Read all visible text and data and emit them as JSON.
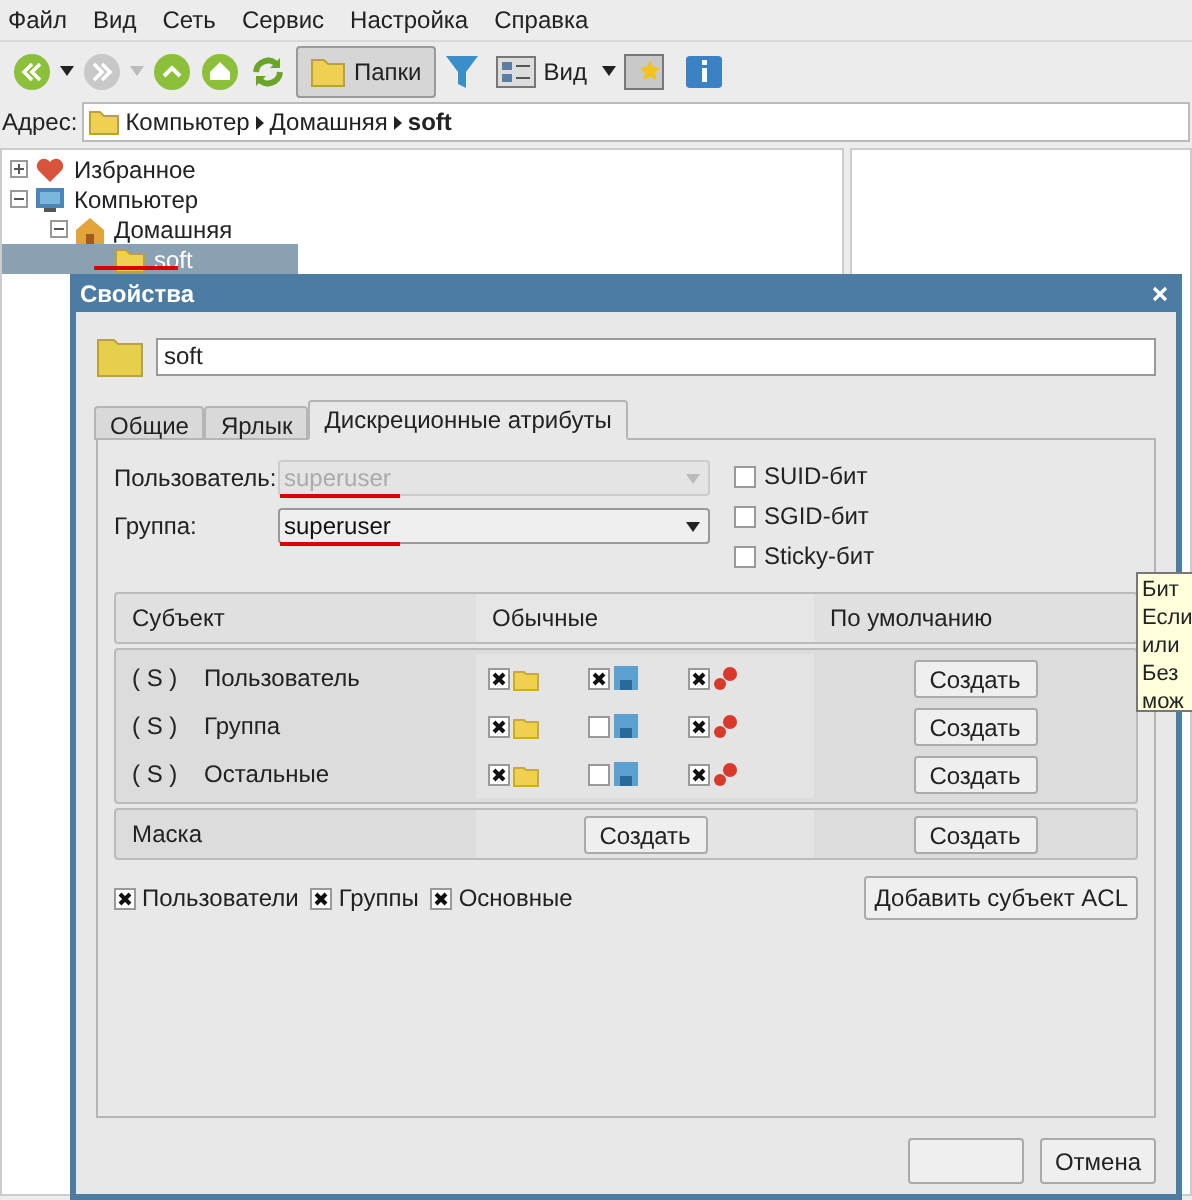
{
  "menu": [
    "Файл",
    "Вид",
    "Сеть",
    "Сервис",
    "Настройка",
    "Справка"
  ],
  "toolbar": [
    {
      "kind": "back",
      "disabled": false
    },
    {
      "kind": "forward",
      "disabled": true
    },
    {
      "kind": "up",
      "disabled": false
    },
    {
      "kind": "home",
      "disabled": false
    },
    {
      "kind": "refresh",
      "disabled": false
    },
    {
      "kind": "folders",
      "label": "Папки",
      "selected": true
    },
    {
      "kind": "filter"
    },
    {
      "kind": "view",
      "label": "Вид"
    },
    {
      "kind": "star"
    },
    {
      "kind": "info"
    }
  ],
  "address": {
    "label": "Адрес:",
    "segments": [
      {
        "text": "Компьютер",
        "bold": false
      },
      {
        "text": "Домашняя",
        "bold": false
      },
      {
        "text": "soft",
        "bold": true
      }
    ]
  },
  "tree": [
    {
      "label": "Избранное",
      "kind": "favorites",
      "expanded": false,
      "selected": false
    },
    {
      "label": "Компьютер",
      "kind": "computer",
      "expanded": true,
      "selected": false,
      "children": [
        {
          "label": "Домашняя",
          "kind": "home",
          "expanded": true,
          "selected": false,
          "children": [
            {
              "label": "soft",
              "kind": "folder",
              "selected": true
            }
          ]
        }
      ]
    }
  ],
  "dialog": {
    "title": "Свойства",
    "name": "soft",
    "tabs": [
      {
        "label": "Общие",
        "selected": false
      },
      {
        "label": "Ярлык",
        "selected": false
      },
      {
        "label": "Дискреционные атрибуты",
        "selected": true
      }
    ],
    "owner": [
      {
        "label": "Пользователь:",
        "value": "superuser",
        "disabled": true
      },
      {
        "label": "Группа:",
        "value": "superuser",
        "disabled": false
      }
    ],
    "bits": [
      {
        "label": "SUID-бит",
        "checked": false
      },
      {
        "label": "SGID-бит",
        "checked": false
      },
      {
        "label": "Sticky-бит",
        "checked": false
      }
    ],
    "acl": {
      "columns": [
        "Субъект",
        "Обычные",
        "По умолчанию"
      ],
      "rows": [
        {
          "flag": "( S )",
          "subject": "Пользователь",
          "read": true,
          "write": true,
          "exec": true,
          "default_button": "Создать"
        },
        {
          "flag": "( S )",
          "subject": "Группа",
          "read": true,
          "write": false,
          "exec": true,
          "default_button": "Создать"
        },
        {
          "flag": "( S )",
          "subject": "Остальные",
          "read": true,
          "write": false,
          "exec": true,
          "default_button": "Создать"
        }
      ],
      "mask": {
        "label": "Маска",
        "normal_button": "Создать",
        "default_button": "Создать"
      }
    },
    "filters": [
      {
        "label": "Пользователи",
        "checked": true
      },
      {
        "label": "Группы",
        "checked": true
      },
      {
        "label": "Основные",
        "checked": true
      }
    ],
    "add_button": "Добавить субъект ACL",
    "buttons": [
      {
        "kind": "blank"
      },
      {
        "kind": "text",
        "label": "Отмена"
      }
    ]
  },
  "tooltip": [
    "Бит",
    "Если",
    "или",
    "Без",
    "мож"
  ]
}
